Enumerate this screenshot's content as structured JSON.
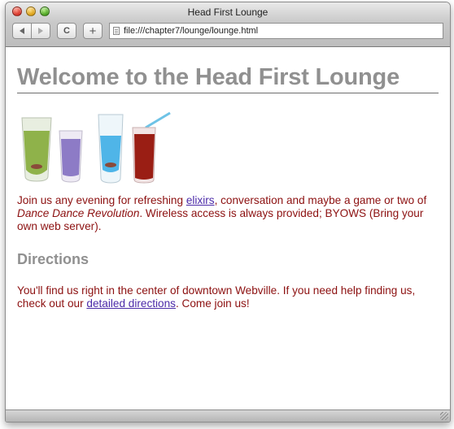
{
  "window": {
    "title": "Head First Lounge"
  },
  "toolbar": {
    "reload_glyph": "C",
    "add_glyph": "+",
    "url": "file:///chapter7/lounge/lounge.html"
  },
  "page": {
    "heading": "Welcome to the Head First Lounge",
    "intro": {
      "before_link": "Join us any evening for refreshing ",
      "link": "elixirs",
      "after_link": ", conversation and maybe a game or two of ",
      "emphasis": "Dance Dance Revolution",
      "end": ". Wireless access is always provided; BYOWS (Bring your own web server)."
    },
    "directions_heading": "Directions",
    "directions": {
      "before_link": "You'll find us right in the center of downtown Webville. If you need help finding us, check out our ",
      "link": "detailed directions",
      "end": ". Come join us!"
    }
  },
  "colors": {
    "body_text": "#8c1010",
    "heading_gray": "#909090",
    "link": "#4b2aa8"
  },
  "icons": [
    "close-light",
    "minimize-light",
    "maximize-light",
    "back-arrow-icon",
    "forward-arrow-icon",
    "reload-icon",
    "add-bookmark-icon",
    "page-icon",
    "resize-grip-icon"
  ]
}
